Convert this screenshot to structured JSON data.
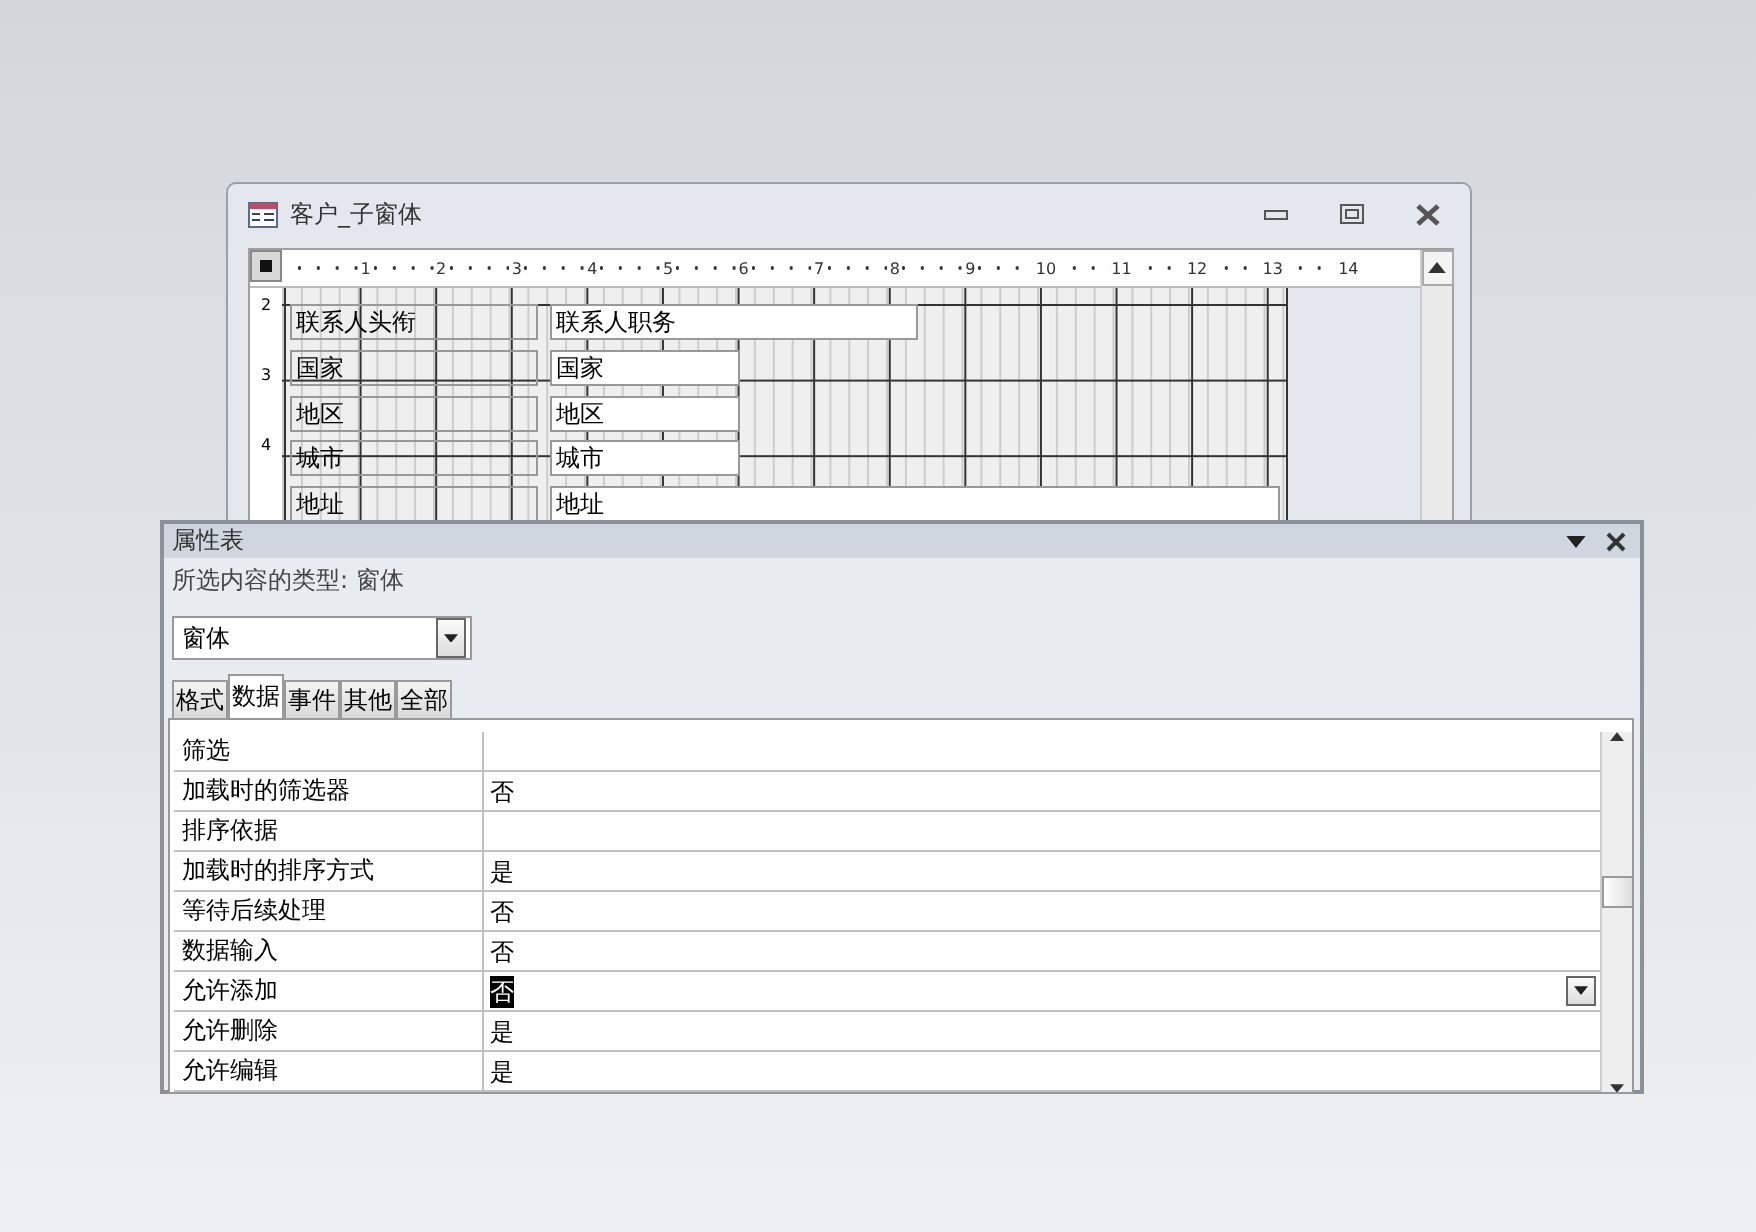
{
  "form_window": {
    "title": "客户_子窗体",
    "ruler_marks": [
      "1",
      "2",
      "3",
      "4",
      "5",
      "6",
      "7",
      "8",
      "9",
      "10",
      "11",
      "12",
      "13",
      "14"
    ],
    "vertical_ruler_marks": [
      "2",
      "3",
      "4"
    ],
    "controls": [
      {
        "label": "联系人头衔",
        "field": "联系人职务"
      },
      {
        "label": "国家",
        "field": "国家"
      },
      {
        "label": "地区",
        "field": "地区"
      },
      {
        "label": "城市",
        "field": "城市"
      },
      {
        "label": "地址",
        "field": "地址"
      }
    ]
  },
  "property_sheet": {
    "title": "属性表",
    "selection_type": "所选内容的类型: 窗体",
    "object_selector": "窗体",
    "tabs": [
      {
        "label": "格式",
        "selected": false
      },
      {
        "label": "数据",
        "selected": true
      },
      {
        "label": "事件",
        "selected": false
      },
      {
        "label": "其他",
        "selected": false
      },
      {
        "label": "全部",
        "selected": false
      }
    ],
    "properties": [
      {
        "name": "筛选",
        "selected": false
      },
      {
        "name": "加载时的筛选器",
        "value": "否",
        "selected": false
      },
      {
        "name": "排序依据",
        "selected": false
      },
      {
        "name": "加载时的排序方式",
        "value": "是",
        "selected": false
      },
      {
        "name": "等待后续处理",
        "value": "否",
        "selected": false
      },
      {
        "name": "数据输入",
        "value": "否",
        "selected": false
      },
      {
        "name": "允许添加",
        "value": "否",
        "selected": true
      },
      {
        "name": "允许删除",
        "value": "是",
        "selected": false
      },
      {
        "name": "允许编辑",
        "value": "是",
        "selected": false
      }
    ]
  }
}
